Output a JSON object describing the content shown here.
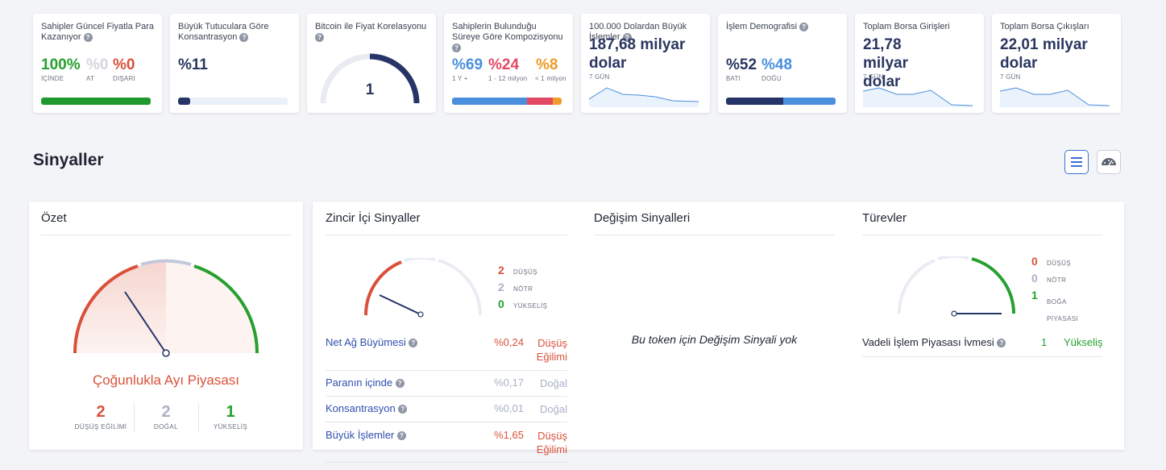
{
  "cards": {
    "profit": {
      "title": "Sahipler Güncel Fiyatla Para Kazanıyor",
      "in_value": "100%",
      "in_label": "İÇİNDE",
      "at_value": "%0",
      "at_label": "AT",
      "out_value": "%0",
      "out_label": "DIŞARI",
      "in_fraction": 1.0
    },
    "concentration": {
      "title": "Büyük Tutuculara Göre Konsantrasyon",
      "value": "%11",
      "fraction": 0.11
    },
    "correlation": {
      "title": "Bitcoin ile Fiyat Korelasyonu",
      "value": "1"
    },
    "composition": {
      "title": "Sahiplerin Bulunduğu Süreye Göre Kompozisyonu",
      "v1": "%69",
      "l1": "1 Y +",
      "v2": "%24",
      "l2": "1 - 12 milyon",
      "v3": "%8",
      "l3": "< 1 milyon",
      "f1": 0.69,
      "f2": 0.24,
      "f3": 0.08
    },
    "large_tx": {
      "title": "100.000 Dolardan Büyük İşlemler",
      "value": "187,68 milyar dolar",
      "period": "7 GÜN"
    },
    "demographics": {
      "title": "İşlem Demografisi",
      "west_value": "%52",
      "west_label": "BATI",
      "east_value": "%48",
      "east_label": "DOĞU",
      "west_fraction": 0.52
    },
    "inflows": {
      "title": "Toplam Borsa Girişleri",
      "value": "21,78 milyar dolar",
      "period": "7 GÜN"
    },
    "outflows": {
      "title": "Toplam Borsa Çıkışları",
      "value": "22,01 milyar dolar",
      "period": "7 GÜN"
    }
  },
  "signals": {
    "title": "Sinyaller",
    "toolbar": {
      "list_icon": "list-view-icon",
      "gauge_icon": "gauge-view-icon"
    },
    "summary": {
      "title": "Özet",
      "verdict": "Çoğunlukla Ayı Piyasası",
      "bear_count": "2",
      "bear_label": "DÜŞÜŞ EĞİLİMİ",
      "neutral_count": "2",
      "neutral_label": "DOĞAL",
      "bull_count": "1",
      "bull_label": "YÜKSELİŞ"
    },
    "onchain": {
      "title": "Zincir İçi Sinyaller",
      "bear_count": "2",
      "bear_label": "DÜŞÜŞ",
      "neutral_count": "2",
      "neutral_label": "NÖTR",
      "bull_count": "0",
      "bull_label": "YÜKSELİŞ",
      "rows": [
        {
          "name": "Net Ağ Büyümesi",
          "value": "%0,24",
          "result": "Düşüş Eğilimi",
          "tone": "bear"
        },
        {
          "name": "Paranın içinde",
          "value": "%0,17",
          "result": "Doğal",
          "tone": "neutral"
        },
        {
          "name": "Konsantrasyon",
          "value": "%0,01",
          "result": "Doğal",
          "tone": "neutral"
        },
        {
          "name": "Büyük İşlemler",
          "value": "%1,65",
          "result": "Düşüş Eğilimi",
          "tone": "bear"
        }
      ]
    },
    "exchange": {
      "title": "Değişim Sinyalleri",
      "empty": "Bu token için Değişim Sinyali yok"
    },
    "derivatives": {
      "title": "Türevler",
      "bear_count": "0",
      "bear_label": "DÜŞÜŞ",
      "neutral_count": "0",
      "neutral_label": "NÖTR",
      "bull_count": "1",
      "bull_label": "BOĞA PİYASASI",
      "row": {
        "name": "Vadeli İşlem Piyasası İvmesi",
        "value": "1",
        "result": "Yükseliş"
      }
    }
  },
  "colors": {
    "bear": "#d9513b",
    "neutral": "#aab2c8",
    "bull": "#27a02f",
    "navy": "#263468",
    "blue": "#4a8fde"
  }
}
